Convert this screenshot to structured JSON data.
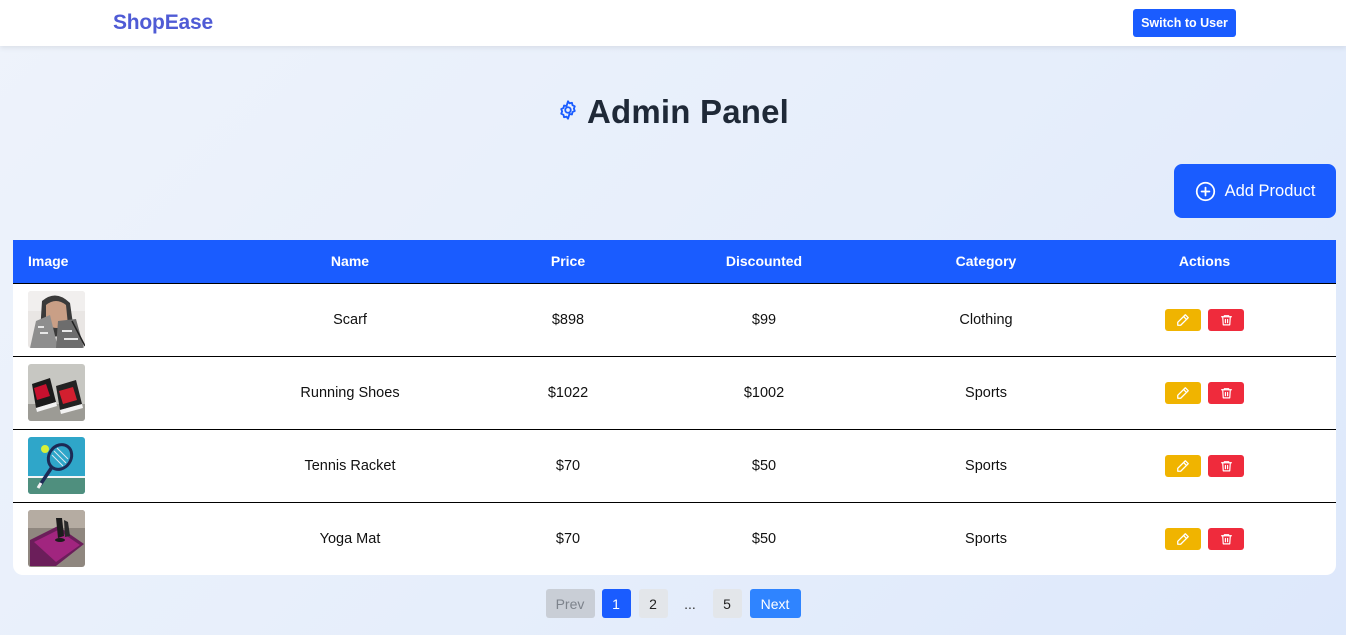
{
  "app": {
    "brand": "ShopEase",
    "switch_label": "Switch to User"
  },
  "header": {
    "title": "Admin Panel",
    "icon": "gear-icon"
  },
  "actions": {
    "add_label": "Add Product",
    "add_icon": "plus-circle-icon"
  },
  "table": {
    "headers": [
      "Image",
      "Name",
      "Price",
      "Discounted",
      "Category",
      "Actions"
    ],
    "rows": [
      {
        "name": "Scarf",
        "price": "$898",
        "discounted": "$99",
        "category": "Clothing",
        "image": "scarf-image"
      },
      {
        "name": "Running Shoes",
        "price": "$1022",
        "discounted": "$1002",
        "category": "Sports",
        "image": "running-shoes-image"
      },
      {
        "name": "Tennis Racket",
        "price": "$70",
        "discounted": "$50",
        "category": "Sports",
        "image": "tennis-racket-image"
      },
      {
        "name": "Yoga Mat",
        "price": "$70",
        "discounted": "$50",
        "category": "Sports",
        "image": "yoga-mat-image"
      }
    ]
  },
  "pagination": {
    "prev": "Prev",
    "pages": [
      "1",
      "2",
      "...",
      "5"
    ],
    "current": "1",
    "next": "Next"
  },
  "colors": {
    "primary": "#1a5cff",
    "brand": "#4f5bd5",
    "edit": "#f0b400",
    "delete": "#ef2b3c"
  }
}
